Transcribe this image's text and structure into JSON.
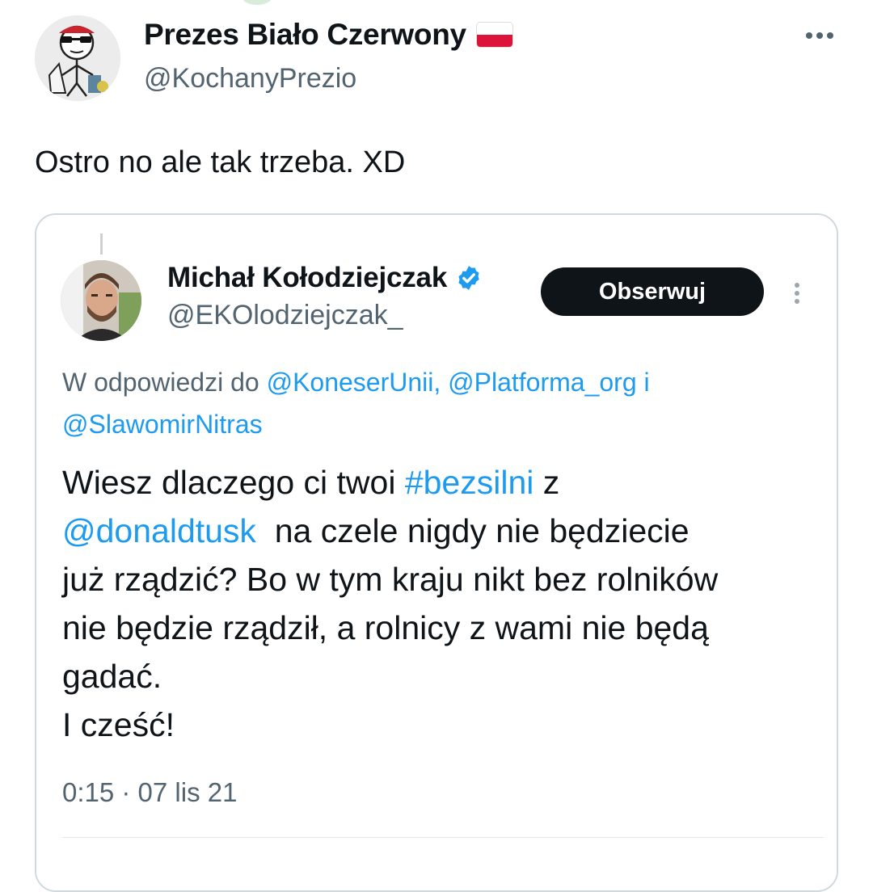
{
  "outer_tweet": {
    "display_name": "Prezes Biało Czerwony",
    "handle": "@KochanyPrezio",
    "text": "Ostro no ale tak trzeba. XD",
    "flag_icon": "poland-flag-icon",
    "more_icon": "more-horizontal-icon"
  },
  "quoted_tweet": {
    "display_name": "Michał Kołodziejczak",
    "handle": "@EKOlodziejczak_",
    "verified_icon": "verified-badge-icon",
    "follow_label": "Obserwuj",
    "more_icon": "more-vertical-icon",
    "reply_prefix": "W odpowiedzi do ",
    "reply_mentions": [
      "@KoneserUnii,",
      "@Platforma_org",
      "i",
      "@SlawomirNitras"
    ],
    "body": {
      "line1_a": "Wiesz dlaczego ci twoi ",
      "line1_hashtag": "#bezsilni",
      "line1_b": " z",
      "line2_mention": "@donaldtusk",
      "line2_b": "  na czele nigdy nie będziecie",
      "line3": "już rządzić? Bo w tym kraju nikt bez rolników",
      "line4": "nie będzie rządził, a rolnicy z wami nie będą",
      "line5": "gadać.",
      "line6": "I cześć!"
    },
    "timestamp": "0:15 · 07 lis 21"
  },
  "colors": {
    "link": "#1d9bf0",
    "secondary_text": "#536471",
    "primary_text": "#0f1419",
    "card_border": "#cfd9de",
    "button_bg": "#0f1419",
    "flag_red": "#dc143c"
  }
}
